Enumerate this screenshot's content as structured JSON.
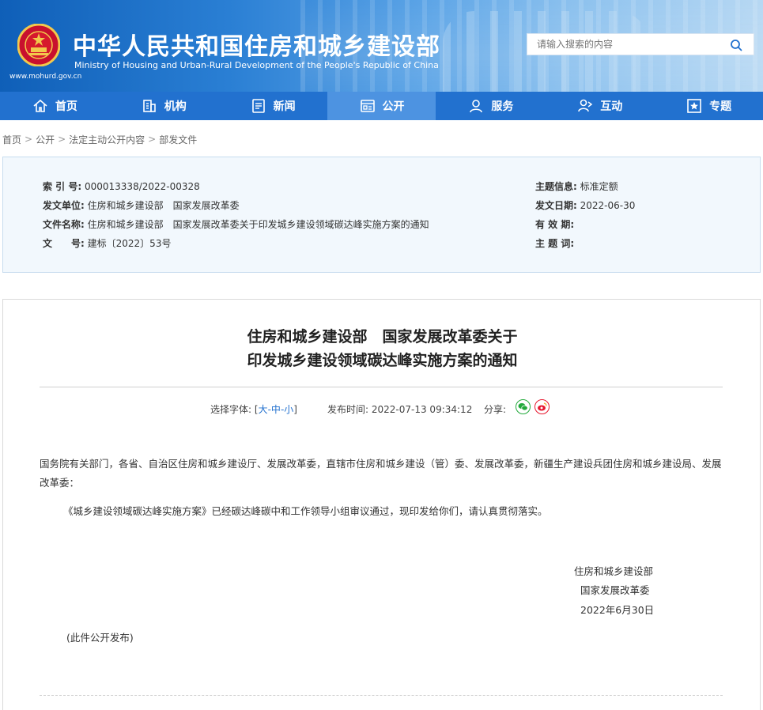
{
  "header": {
    "title": "中华人民共和国住房和城乡建设部",
    "subtitle": "Ministry of Housing and Urban-Rural Development of the People's Republic of China",
    "url": "www.mohurd.gov.cn",
    "search_placeholder": "请输入搜索的内容",
    "search_icon": "search-icon"
  },
  "nav": {
    "items": [
      {
        "label": "首页",
        "icon": "home-icon"
      },
      {
        "label": "机构",
        "icon": "building-icon"
      },
      {
        "label": "新闻",
        "icon": "news-icon"
      },
      {
        "label": "公开",
        "icon": "document-icon"
      },
      {
        "label": "服务",
        "icon": "service-icon"
      },
      {
        "label": "互动",
        "icon": "interaction-icon"
      },
      {
        "label": "专题",
        "icon": "star-icon"
      }
    ],
    "active": "公开"
  },
  "breadcrumb": [
    "首页",
    "公开",
    "法定主动公开内容",
    "部发文件"
  ],
  "info": {
    "index_label": "索 引 号:",
    "index_value": "000013338/2022-00328",
    "issuer_label": "发文单位:",
    "issuer_value": "住房和城乡建设部　国家发展改革委",
    "docname_label": "文件名称:",
    "docname_value": "住房和城乡建设部　国家发展改革委关于印发城乡建设领域碳达峰实施方案的通知",
    "docno_label": "文　　号:",
    "docno_value": "建标〔2022〕53号",
    "topic_label": "主题信息:",
    "topic_value": "标准定额",
    "date_label": "发文日期:",
    "date_value": "2022-06-30",
    "validity_label": "有 效 期:",
    "validity_value": "",
    "keywords_label": "主 题 词:",
    "keywords_value": ""
  },
  "article": {
    "title_line1": "住房和城乡建设部　国家发展改革委关于",
    "title_line2": "印发城乡建设领域碳达峰实施方案的通知",
    "font_label": "选择字体:",
    "font_open": "[",
    "font_large": "大",
    "font_medium": "中",
    "font_small": "小",
    "font_sep": "-",
    "font_close": "]",
    "publish_label": "发布时间:",
    "publish_time": "2022-07-13 09:34:12",
    "share_label": "分享:",
    "para1": "国务院有关部门，各省、自治区住房和城乡建设厅、发展改革委，直辖市住房和城乡建设（管）委、发展改革委，新疆生产建设兵团住房和城乡建设局、发展改革委：",
    "para2": "《城乡建设领域碳达峰实施方案》已经碳达峰碳中和工作领导小组审议通过，现印发给你们，请认真贯彻落实。",
    "sign1": "住房和城乡建设部",
    "sign2": "国家发展改革委",
    "sign_date": "2022年6月30日",
    "note": "(此件公开发布)"
  },
  "colors": {
    "nav_bg": "#2271cf",
    "nav_active": "#4d93e1",
    "info_bg": "#f2f8fd",
    "wechat": "#22a93b",
    "weibo": "#e6162d"
  }
}
